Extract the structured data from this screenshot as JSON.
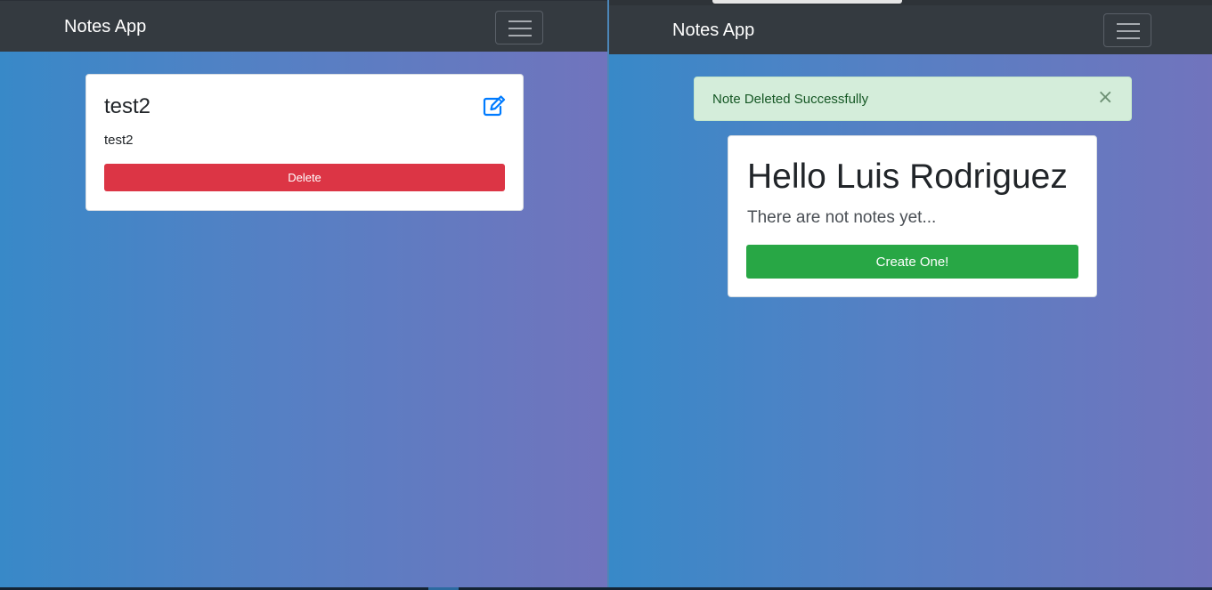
{
  "left_window": {
    "navbar": {
      "brand": "Notes App",
      "menu_icon": "hamburger-icon"
    },
    "note": {
      "title": "test2",
      "description": "test2",
      "edit_icon": "edit-icon",
      "delete_label": "Delete"
    }
  },
  "right_window": {
    "navbar": {
      "brand": "Notes App",
      "menu_icon": "hamburger-icon"
    },
    "alert": {
      "message": "Note Deleted Successfully",
      "close_label": "×"
    },
    "welcome": {
      "title": "Hello Luis Rodriguez",
      "lead": "There are not notes yet...",
      "create_label": "Create One!"
    }
  },
  "colors": {
    "navbar": "#343a40",
    "gradient_start": "#3889c8",
    "gradient_end": "#7174bd",
    "danger": "#dc3545",
    "success": "#28a745",
    "alert_bg": "#d4edda",
    "alert_text": "#155724",
    "edit_icon": "#007bff"
  }
}
